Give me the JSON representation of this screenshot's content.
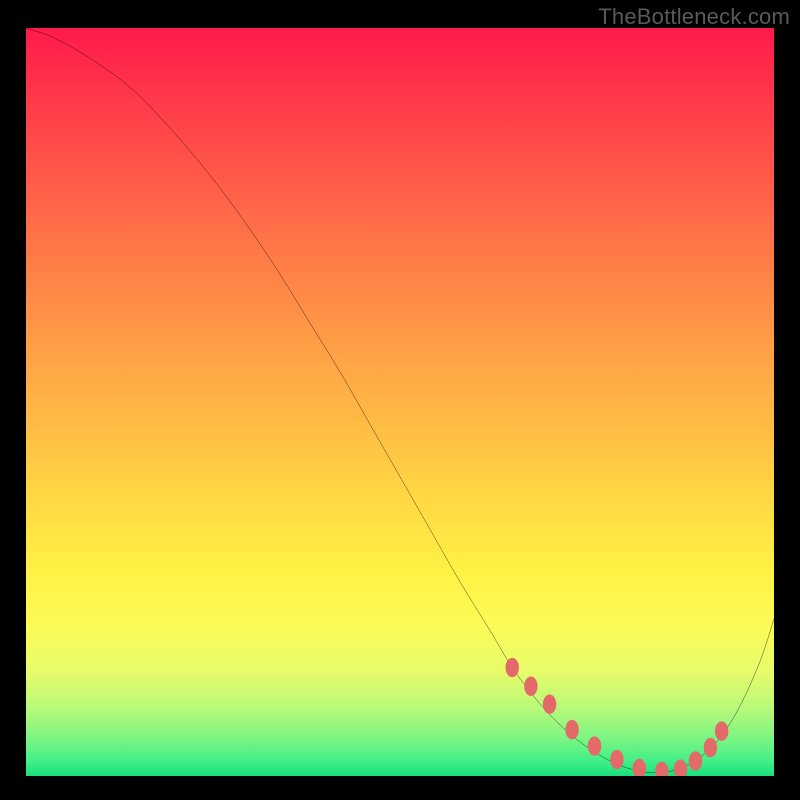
{
  "watermark": "TheBottleneck.com",
  "colors": {
    "background": "#000000",
    "watermark_text": "#5a5a5a",
    "curve_stroke": "#000000",
    "dot_fill": "#e46a6a",
    "gradient_top": "#ff1a4b",
    "gradient_bottom": "#18e07e"
  },
  "chart_data": {
    "type": "line",
    "title": "",
    "xlabel": "",
    "ylabel": "",
    "xlim": [
      0,
      100
    ],
    "ylim": [
      0,
      100
    ],
    "grid": false,
    "legend": false,
    "series": [
      {
        "name": "bottleneck-curve",
        "x": [
          0,
          3,
          6,
          10,
          14,
          18,
          22,
          26,
          30,
          34,
          38,
          42,
          46,
          50,
          54,
          58,
          62,
          65,
          68,
          71,
          74,
          77,
          80,
          83,
          86,
          89,
          92,
          95,
          98,
          100
        ],
        "y": [
          100,
          99,
          97.5,
          95,
          92,
          88,
          83.5,
          78.5,
          73,
          67,
          60.5,
          54,
          47,
          40,
          33,
          26,
          19.5,
          14.5,
          10.5,
          7.2,
          4.6,
          2.6,
          1.2,
          0.5,
          0.6,
          1.8,
          4.2,
          8.5,
          15,
          21
        ]
      }
    ],
    "highlight_points": {
      "name": "optimum-range-dots",
      "x": [
        65,
        67.5,
        70,
        73,
        76,
        79,
        82,
        85,
        87.5,
        89.5,
        91.5,
        93
      ],
      "y": [
        14.5,
        12,
        9.6,
        6.2,
        4.0,
        2.2,
        1.0,
        0.6,
        0.9,
        2.0,
        3.8,
        6.0
      ]
    }
  }
}
